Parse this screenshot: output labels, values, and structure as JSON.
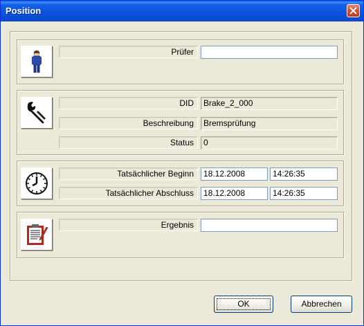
{
  "window": {
    "title": "Position"
  },
  "sections": {
    "inspector": {
      "label": "Prüfer",
      "value": ""
    },
    "details": {
      "did_label": "DID",
      "did_value": "Brake_2_000",
      "description_label": "Beschreibung",
      "description_value": "Bremsprüfung",
      "status_label": "Status",
      "status_value": "0"
    },
    "timing": {
      "begin_label": "Tatsächlicher  Beginn",
      "begin_date": "18.12.2008",
      "begin_time": "14:26:35",
      "end_label": "Tatsächlicher Abschluss",
      "end_date": "18.12.2008",
      "end_time": "14:26:35"
    },
    "result": {
      "label": "Ergebnis",
      "value": ""
    }
  },
  "buttons": {
    "ok": "OK",
    "cancel": "Abbrechen"
  },
  "icons": [
    "person-icon",
    "wrench-icon",
    "clock-icon",
    "clipboard-icon",
    "close-icon"
  ],
  "colors": {
    "titlebar": "#0a4fd8",
    "dialog_bg": "#ece9d8",
    "close_button": "#d1502f"
  }
}
